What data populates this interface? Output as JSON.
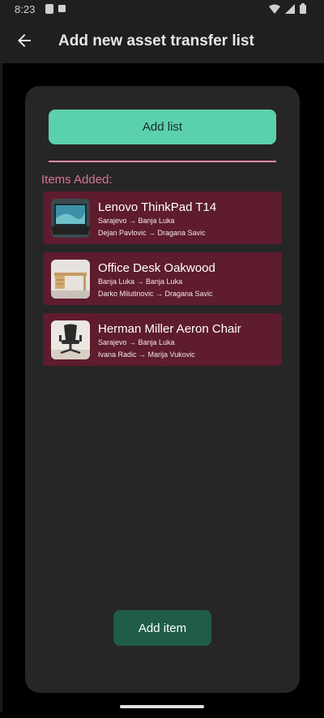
{
  "status_bar": {
    "time": "8:23"
  },
  "app_bar": {
    "title": "Add new asset transfer list"
  },
  "actions": {
    "add_list_label": "Add list",
    "add_item_label": "Add item"
  },
  "items_heading": "Items Added:",
  "items": [
    {
      "name": "Lenovo ThinkPad T14",
      "route": "Sarajevo → Banja Luka",
      "people": "Dejan Pavlovic → Dragana Savic",
      "thumb_icon": "laptop-thumbnail"
    },
    {
      "name": "Office Desk Oakwood",
      "route": "Banja Luka  → Banja Luka",
      "people": "Darko Milutinovic → Dragana Savic",
      "thumb_icon": "desk-thumbnail"
    },
    {
      "name": "Herman Miller Aeron Chair",
      "route": "Sarajevo → Banja Luka",
      "people": "Ivana Radic → Marija Vukovic",
      "thumb_icon": "chair-thumbnail"
    }
  ],
  "colors": {
    "accent": "#5bd0ad",
    "item_background": "#5e1c2e",
    "heading": "#d8759a",
    "add_item": "#1f5d48"
  }
}
